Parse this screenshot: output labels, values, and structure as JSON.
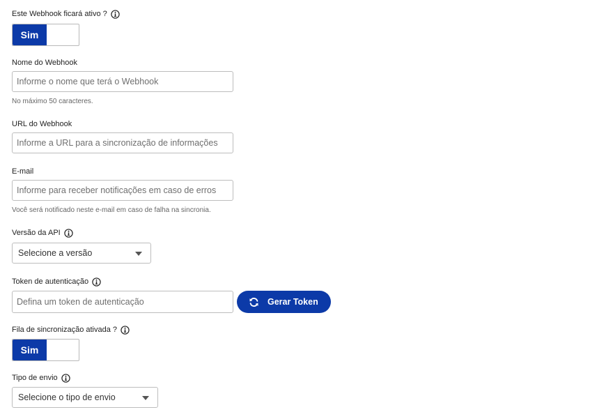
{
  "active_toggle": {
    "label": "Este Webhook ficará ativo ?",
    "value": "Sim"
  },
  "name_field": {
    "label": "Nome do Webhook",
    "placeholder": "Informe o nome que terá o Webhook",
    "hint": "No máximo 50 caracteres."
  },
  "url_field": {
    "label": "URL do Webhook",
    "placeholder": "Informe a URL para a sincronização de informações"
  },
  "email_field": {
    "label": "E-mail",
    "placeholder": "Informe para receber notificações em caso de erros",
    "hint": "Você será notificado neste e-mail em caso de falha na sincronia."
  },
  "api_version": {
    "label": "Versão da API",
    "selected": "Selecione a versão"
  },
  "token_field": {
    "label": "Token de autenticação",
    "placeholder": "Defina um token de autenticação",
    "generate_button": "Gerar Token"
  },
  "sync_queue_toggle": {
    "label": "Fila de sincronização ativada ?",
    "value": "Sim"
  },
  "send_type": {
    "label": "Tipo de envio",
    "selected": "Selecione o tipo de envio"
  },
  "colors": {
    "primary": "#0c3aa8",
    "border": "#bdbdbd"
  },
  "icons": [
    "info-icon",
    "refresh-icon",
    "chevron-down-icon"
  ]
}
